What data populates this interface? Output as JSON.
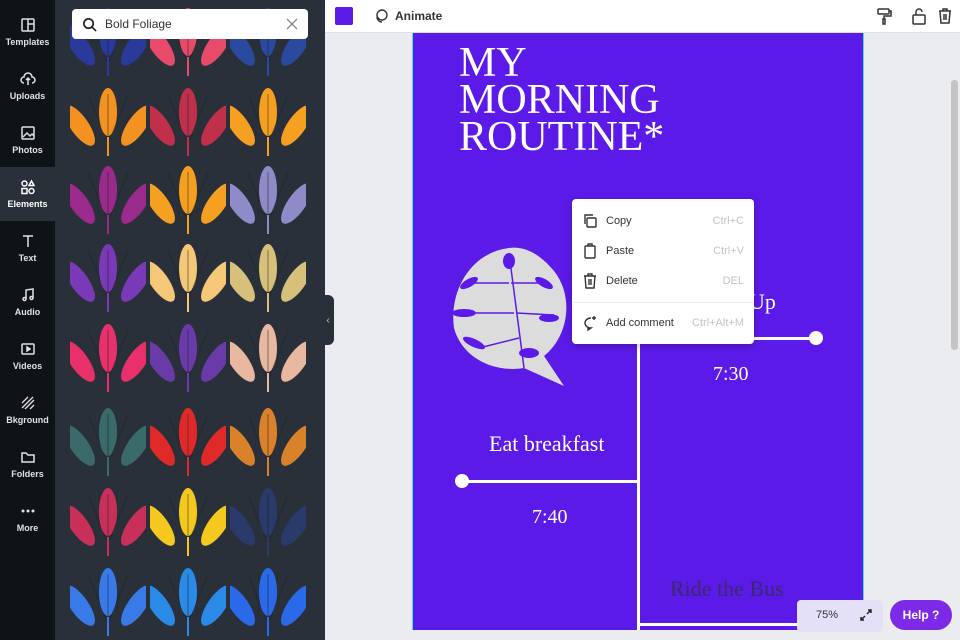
{
  "sidebar": {
    "items": [
      {
        "label": "Templates",
        "icon": "templates-icon"
      },
      {
        "label": "Uploads",
        "icon": "upload-icon"
      },
      {
        "label": "Photos",
        "icon": "photo-icon"
      },
      {
        "label": "Elements",
        "icon": "elements-icon",
        "active": true
      },
      {
        "label": "Text",
        "icon": "text-icon"
      },
      {
        "label": "Audio",
        "icon": "music-icon"
      },
      {
        "label": "Videos",
        "icon": "video-icon"
      },
      {
        "label": "Bkground",
        "icon": "background-icon"
      },
      {
        "label": "Folders",
        "icon": "folder-icon"
      },
      {
        "label": "More",
        "icon": "more-icon"
      }
    ]
  },
  "search": {
    "value": "Bold Foliage"
  },
  "foliage_colors": [
    [
      "#2a3a9c",
      "#e84a6a",
      "#2a4aa0"
    ],
    [
      "#f39220",
      "#c0304a",
      "#f5a020"
    ],
    [
      "#9a2a8c",
      "#f5a020",
      "#8f8ac8"
    ],
    [
      "#7a3ab8",
      "#f5c878",
      "#d6c07a"
    ],
    [
      "#e8306a",
      "#6a3aa8",
      "#e8b8a0"
    ],
    [
      "#3a6a6a",
      "#e02a2a",
      "#d9822b"
    ],
    [
      "#c8305a",
      "#f5c820",
      "#2a3a6a"
    ],
    [
      "#3a7ae8",
      "#2a8ae8",
      "#2a6ae8"
    ]
  ],
  "topbar": {
    "color": "#5c1ae8",
    "animate_label": "Animate"
  },
  "page": {
    "title_lines": [
      "MY",
      "MORNING",
      "ROUTINE*"
    ],
    "wake_up": "Up",
    "time1": "7:30",
    "eat": "Eat breakfast",
    "time2": "7:40",
    "bus": "Ride the Bus",
    "bg": "#5c1ae8"
  },
  "context_menu": [
    {
      "label": "Copy",
      "shortcut": "Ctrl+C"
    },
    {
      "label": "Paste",
      "shortcut": "Ctrl+V"
    },
    {
      "label": "Delete",
      "shortcut": "DEL"
    },
    {
      "label": "Add comment",
      "shortcut": "Ctrl+Alt+M"
    }
  ],
  "zoom": {
    "value": "75%"
  },
  "help": {
    "label": "Help ?"
  }
}
